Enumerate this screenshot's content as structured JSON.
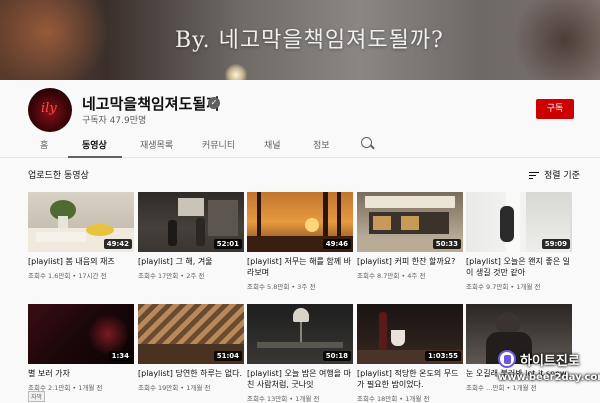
{
  "banner": {
    "title": "By. 네고막을책임져도될까?"
  },
  "channel": {
    "name": "네고막을책임져도될까",
    "subscribers": "구독자 47.9만명",
    "avatar_text": "ily",
    "subscribe_label": "구독"
  },
  "tabs": [
    {
      "label": "홈"
    },
    {
      "label": "동영상",
      "active": true
    },
    {
      "label": "재생목록"
    },
    {
      "label": "커뮤니티"
    },
    {
      "label": "채널"
    },
    {
      "label": "정보"
    }
  ],
  "section": {
    "title": "업로드한 동영상",
    "sort_label": "정렬 기준"
  },
  "videos": [
    {
      "title": "[playlist] 봄 내음의 재즈",
      "meta": "조회수 1.6만회 • 17시간 전",
      "duration": "49:42"
    },
    {
      "title": "[playlist] 그 해, 겨울",
      "meta": "조회수 17만회 • 2주 전",
      "duration": "52:01"
    },
    {
      "title": "[playlist] 저무는 해를 함께 바라보며",
      "meta": "조회수 5.8만회 • 3주 전",
      "duration": "49:46"
    },
    {
      "title": "[playlist] 커피 한잔 할까요?",
      "meta": "조회수 8.7만회 • 4주 전",
      "duration": "50:33"
    },
    {
      "title": "[playlist] 오늘은 왠지 좋은 일이 생길 것만 같아",
      "meta": "조회수 9.7만회 • 1개월 전",
      "duration": "59:09"
    },
    {
      "title": "별 보러 가자",
      "meta": "조회수 2.1만회 • 1개월 전",
      "duration": "1:34",
      "caption": "자막"
    },
    {
      "title": "[playlist] 당연한 하루는 없다.",
      "meta": "조회수 19만회 • 1개월 전",
      "duration": "51:04"
    },
    {
      "title": "[playlist] 오늘 밤은 여행을 마친 사람처럼, 굿나잇",
      "meta": "조회수 13만회 • 1개월 전",
      "duration": "50:18"
    },
    {
      "title": "[playlist] 적당한 온도의 무드가 필요한 밤이었다.",
      "meta": "조회수 18만회 • 1개월 전",
      "duration": "1:03:55"
    },
    {
      "title": "눈 오길래 불러봐 let it snow",
      "meta": "조회수 …만회 • 1개월 전",
      "duration": ""
    }
  ],
  "watermark": {
    "name": "하이트진로",
    "url": "www.beer2day.com"
  },
  "icons": {
    "verified": "check-icon",
    "search": "search-icon",
    "sort": "sort-icon"
  }
}
